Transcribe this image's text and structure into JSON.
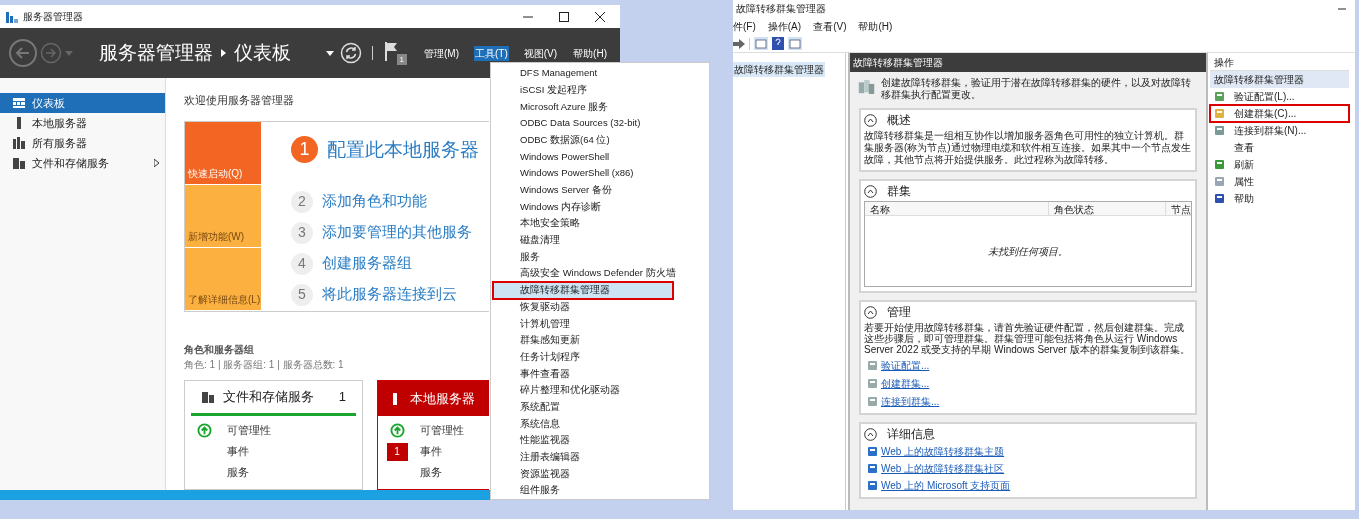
{
  "server_manager": {
    "window_title": "服务器管理器",
    "breadcrumb": [
      "服务器管理器",
      "仪表板"
    ],
    "notification_count": "1",
    "menu_bar": [
      {
        "label": "管理(M)",
        "selected": false
      },
      {
        "label": "工具(T)",
        "selected": true
      },
      {
        "label": "视图(V)",
        "selected": false
      },
      {
        "label": "帮助(H)",
        "selected": false
      }
    ],
    "sidebar": [
      {
        "label": "仪表板",
        "selected": true,
        "expandable": false,
        "kind": "dashboard"
      },
      {
        "label": "本地服务器",
        "selected": false,
        "expandable": false,
        "kind": "server"
      },
      {
        "label": "所有服务器",
        "selected": false,
        "expandable": false,
        "kind": "servers"
      },
      {
        "label": "文件和存储服务",
        "selected": false,
        "expandable": true,
        "kind": "storage"
      }
    ],
    "welcome_title": "欢迎使用服务器管理器",
    "quick_start": {
      "tiles": [
        "快速启动(Q)",
        "新增功能(W)",
        "了解详细信息(L)"
      ],
      "steps": [
        {
          "number": "1",
          "label": "配置此本地服务器",
          "kind": "main"
        },
        {
          "number": "2",
          "label": "添加角色和功能",
          "kind": "step"
        },
        {
          "number": "3",
          "label": "添加要管理的其他服务",
          "kind": "step"
        },
        {
          "number": "4",
          "label": "创建服务器组",
          "kind": "step"
        },
        {
          "number": "5",
          "label": "将此服务器连接到云",
          "kind": "step"
        }
      ]
    },
    "roles": {
      "title": "角色和服务器组",
      "summary": "角色: 1 | 服务器组: 1 | 服务器总数: 1",
      "tiles": [
        {
          "title": "文件和存储服务",
          "count": "1",
          "alert": false,
          "rows": [
            {
              "label": "可管理性",
              "kind": "status"
            },
            {
              "label": "事件",
              "kind": "plain"
            },
            {
              "label": "服务",
              "kind": "plain"
            }
          ]
        },
        {
          "title": "本地服务器",
          "alert": true,
          "rows": [
            {
              "label": "可管理性",
              "kind": "status"
            },
            {
              "label": "事件",
              "kind": "count",
              "count": "1"
            },
            {
              "label": "服务",
              "kind": "plain"
            }
          ]
        }
      ]
    },
    "tools_menu": [
      {
        "label": "DFS Management",
        "selected": false,
        "marked": false
      },
      {
        "label": "iSCSI 发起程序",
        "selected": false,
        "marked": false
      },
      {
        "label": "Microsoft Azure 服务",
        "selected": false,
        "marked": false
      },
      {
        "label": "ODBC Data Sources (32-bit)",
        "selected": false,
        "marked": false
      },
      {
        "label": "ODBC 数据源(64 位)",
        "selected": false,
        "marked": false
      },
      {
        "label": "Windows PowerShell",
        "selected": false,
        "marked": false
      },
      {
        "label": "Windows PowerShell (x86)",
        "selected": false,
        "marked": false
      },
      {
        "label": "Windows Server 备份",
        "selected": false,
        "marked": false
      },
      {
        "label": "Windows 内存诊断",
        "selected": false,
        "marked": false
      },
      {
        "label": "本地安全策略",
        "selected": false,
        "marked": false
      },
      {
        "label": "磁盘清理",
        "selected": false,
        "marked": false
      },
      {
        "label": "服务",
        "selected": false,
        "marked": false
      },
      {
        "label": "高级安全 Windows Defender 防火墙",
        "selected": false,
        "marked": false
      },
      {
        "label": "故障转移群集管理器",
        "selected": true,
        "marked": true
      },
      {
        "label": "恢复驱动器",
        "selected": false,
        "marked": false
      },
      {
        "label": "计算机管理",
        "selected": false,
        "marked": false
      },
      {
        "label": "群集感知更新",
        "selected": false,
        "marked": false
      },
      {
        "label": "任务计划程序",
        "selected": false,
        "marked": false
      },
      {
        "label": "事件查看器",
        "selected": false,
        "marked": false
      },
      {
        "label": "碎片整理和优化驱动器",
        "selected": false,
        "marked": false
      },
      {
        "label": "系统配置",
        "selected": false,
        "marked": false
      },
      {
        "label": "系统信息",
        "selected": false,
        "marked": false
      },
      {
        "label": "性能监视器",
        "selected": false,
        "marked": false
      },
      {
        "label": "注册表编辑器",
        "selected": false,
        "marked": false
      },
      {
        "label": "资源监视器",
        "selected": false,
        "marked": false
      },
      {
        "label": "组件服务",
        "selected": false,
        "marked": false
      }
    ]
  },
  "cluster_manager": {
    "window_title": "故障转移群集管理器",
    "menu_bar": [
      "件(F)",
      "操作(A)",
      "查看(V)",
      "帮助(H)"
    ],
    "tree": [
      {
        "label": "故障转移群集管理器",
        "selected": true
      }
    ],
    "main_title": "故障转移群集管理器",
    "intro": "创建故障转移群集，验证用于潜在故障转移群集的硬件，以及对故障转移群集执行配置更改。",
    "overview": {
      "title": "概述",
      "text": "故障转移群集是一组相互协作以增加服务器角色可用性的独立计算机。群集服务器(称为节点)通过物理电缆和软件相互连接。如果其中一个节点发生故障，其他节点将开始提供服务。此过程称为故障转移。"
    },
    "clusters": {
      "title": "群集",
      "columns": [
        "名称",
        "角色状态",
        "节点"
      ],
      "empty_text": "未找到任何项目。"
    },
    "management": {
      "title": "管理",
      "text": "若要开始使用故障转移群集，请首先验证硬件配置，然后创建群集。完成这些步骤后，即可管理群集。群集管理可能包括将角色从运行 Windows Server 2022 或受支持的早期 Windows Server 版本的群集复制到该群集。",
      "links": [
        "验证配置...",
        "创建群集...",
        "连接到群集..."
      ]
    },
    "details": {
      "title": "详细信息",
      "links": [
        "Web 上的故障转移群集主题",
        "Web 上的故障转移群集社区",
        "Web 上的 Microsoft 支持页面"
      ]
    },
    "actions": {
      "title": "操作",
      "section": "故障转移群集管理器",
      "items": [
        {
          "label": "验证配置(L)...",
          "kind": "validate",
          "marked": false
        },
        {
          "label": "创建群集(C)...",
          "kind": "create",
          "marked": true
        },
        {
          "label": "连接到群集(N)...",
          "kind": "connect",
          "marked": false
        },
        {
          "label": "查看",
          "kind": "view",
          "marked": false
        },
        {
          "label": "刷新",
          "kind": "refresh",
          "marked": false
        },
        {
          "label": "属性",
          "kind": "properties",
          "marked": false
        },
        {
          "label": "帮助",
          "kind": "help",
          "marked": false
        }
      ]
    }
  }
}
